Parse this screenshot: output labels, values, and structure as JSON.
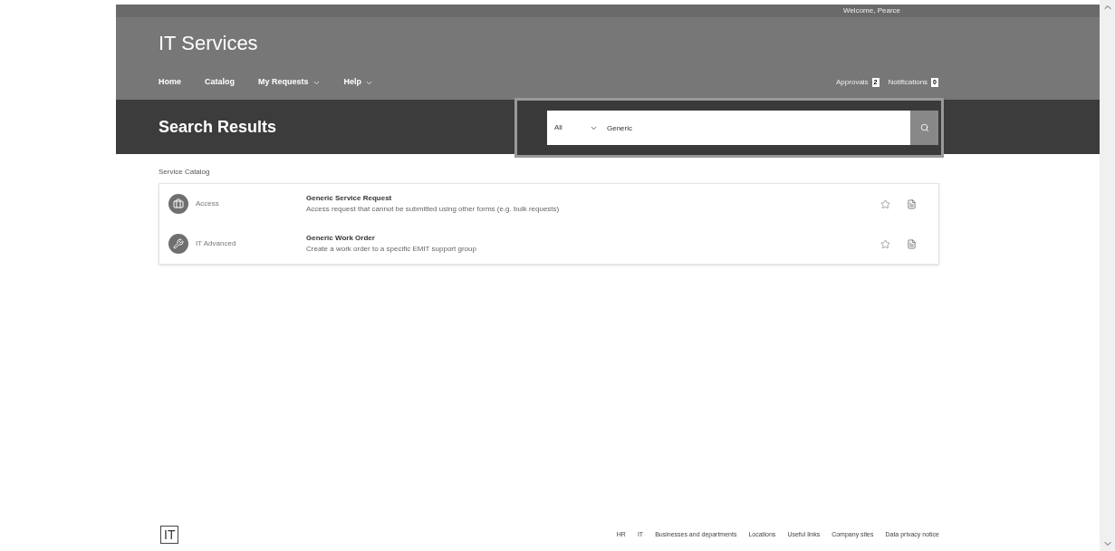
{
  "header": {
    "welcome": "Welcome, Pearce",
    "title": "IT Services",
    "nav": [
      {
        "label": "Home",
        "dropdown": false
      },
      {
        "label": "Catalog",
        "dropdown": false
      },
      {
        "label": "My Requests",
        "dropdown": true
      },
      {
        "label": "Help",
        "dropdown": true
      }
    ],
    "counters": [
      {
        "label": "Approvals",
        "count": "2"
      },
      {
        "label": "Notifications",
        "count": "0"
      }
    ]
  },
  "search_bar": {
    "heading": "Search Results",
    "scope": "All",
    "value": "Generic"
  },
  "results": {
    "section": "Service Catalog",
    "items": [
      {
        "kind": "access",
        "category": "Access",
        "title": "Generic Service Request",
        "description": "Access request that cannot be submitted using other forms (e.g. bulk requests)"
      },
      {
        "kind": "tool",
        "category": "IT Advanced",
        "title": "Generic Work Order",
        "description": "Create a work order to a specific EMIT support group"
      }
    ]
  },
  "footer": {
    "logo": "IT",
    "links": [
      "HR",
      "IT",
      "Businesses and departments",
      "Locations",
      "Useful links",
      "Company sites",
      "Data privacy notice"
    ]
  }
}
